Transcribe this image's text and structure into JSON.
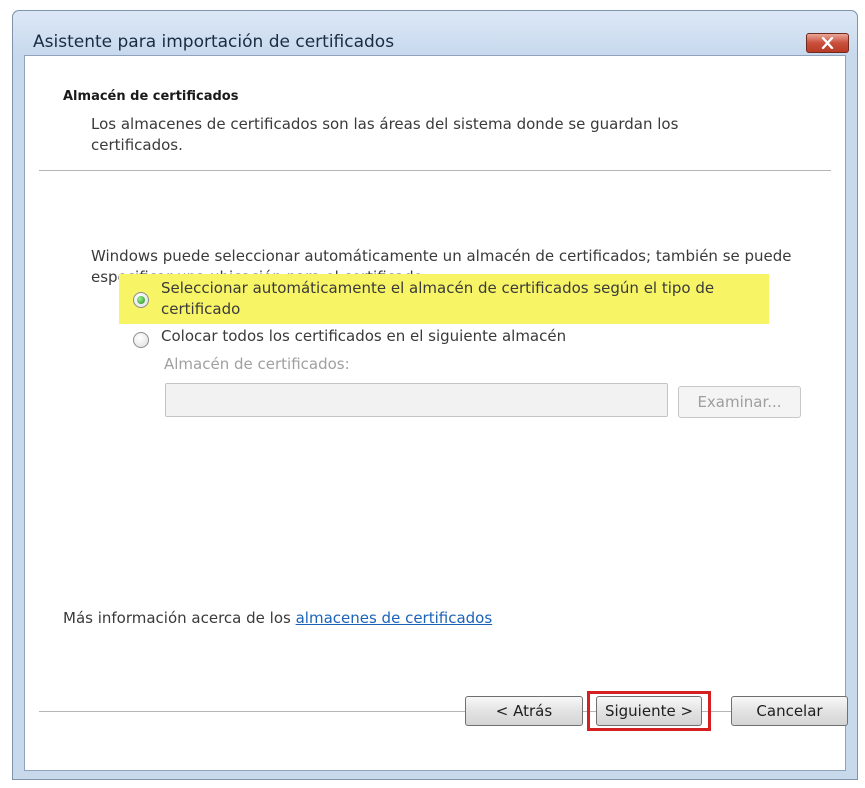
{
  "window": {
    "title": "Asistente para importación de certificados",
    "close_icon": "close-x-icon"
  },
  "header": {
    "title": "Almacén de certificados",
    "description": "Los almacenes de certificados son las áreas del sistema donde se guardan los certificados."
  },
  "body": {
    "intro": "Windows puede seleccionar automáticamente un almacén de certificados; también se puede especificar una ubicación para el certificado.",
    "options": [
      {
        "label": "Seleccionar automáticamente el almacén de certificados según el tipo de certificado",
        "selected": true
      },
      {
        "label": "Colocar todos los certificados en el siguiente almacén",
        "selected": false
      }
    ],
    "store_label": "Almacén de certificados:",
    "store_value": "",
    "browse_label": "Examinar..."
  },
  "footer": {
    "more_info_prefix": "Más información acerca de los ",
    "more_info_link": "almacenes de certificados",
    "back_label": "< Atrás",
    "next_label": "Siguiente >",
    "cancel_label": "Cancelar"
  },
  "colors": {
    "highlight": "#f7f466",
    "next_outline": "#d42020",
    "link": "#1c63b8"
  }
}
